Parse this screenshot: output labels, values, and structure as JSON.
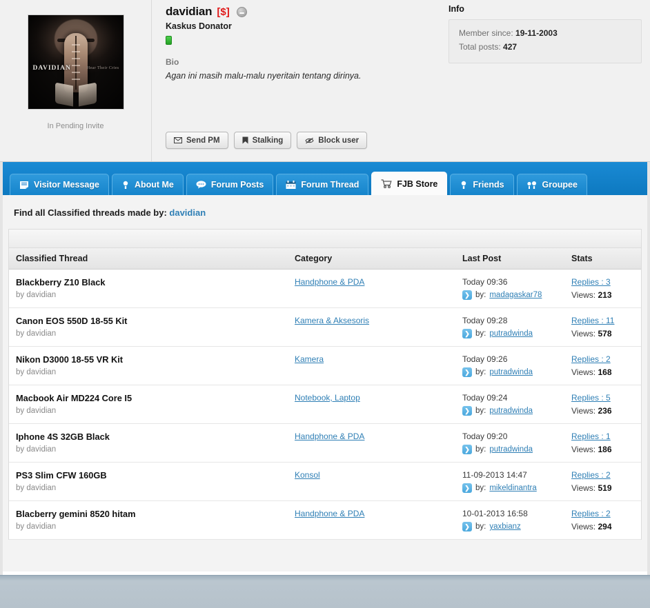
{
  "profile": {
    "avatar": {
      "artwork_title": "DAVIDIAN",
      "artwork_subtitle": "Hear Their Cries",
      "caption": "In Pending Invite"
    },
    "username": "davidian",
    "donator_badge": "[$]",
    "user_title": "Kaskus Donator",
    "bio_label": "Bio",
    "bio_text": "Agan ini masih malu-malu nyeritain tentang dirinya.",
    "buttons": [
      {
        "label": "Send PM",
        "icon": "envelope-icon"
      },
      {
        "label": "Stalking",
        "icon": "bookmark-icon"
      },
      {
        "label": "Block user",
        "icon": "block-eye-icon"
      }
    ],
    "info": {
      "heading": "Info",
      "member_since_label": "Member since:",
      "member_since_value": "19-11-2003",
      "total_posts_label": "Total posts:",
      "total_posts_value": "427"
    }
  },
  "tabs": [
    {
      "label": "Visitor Message",
      "icon": "note-icon",
      "active": false
    },
    {
      "label": "About Me",
      "icon": "person-icon",
      "active": false
    },
    {
      "label": "Forum Posts",
      "icon": "speech-bubble-icon",
      "active": false
    },
    {
      "label": "Forum Thread",
      "icon": "calendar-icon",
      "active": false
    },
    {
      "label": "FJB Store",
      "icon": "shopping-cart-icon",
      "active": true
    },
    {
      "label": "Friends",
      "icon": "person-icon",
      "active": false
    },
    {
      "label": "Groupee",
      "icon": "people-icon",
      "active": false
    }
  ],
  "find_line": {
    "prefix": "Find all Classified threads made by:",
    "username": "davidian"
  },
  "table": {
    "headers": [
      "Classified Thread",
      "Category",
      "Last Post",
      "Stats"
    ],
    "by_prefix": "by",
    "lastpost_by_prefix": "by:",
    "views_label": "Views:",
    "rows": [
      {
        "title": "Blackberry Z10 Black",
        "author": "davidian",
        "category": "Handphone & PDA",
        "last_post_date": "Today 09:36",
        "last_post_by": "madagaskar78",
        "replies": "Replies : 3",
        "views": "213"
      },
      {
        "title": "Canon EOS 550D 18-55 Kit",
        "author": "davidian",
        "category": "Kamera & Aksesoris",
        "last_post_date": "Today 09:28",
        "last_post_by": "putradwinda",
        "replies": "Replies : 11",
        "views": "578"
      },
      {
        "title": "Nikon D3000 18-55 VR Kit",
        "author": "davidian",
        "category": "Kamera",
        "last_post_date": "Today 09:26",
        "last_post_by": "putradwinda",
        "replies": "Replies : 2",
        "views": "168"
      },
      {
        "title": "Macbook Air MD224 Core I5",
        "author": "davidian",
        "category": "Notebook, Laptop",
        "last_post_date": "Today 09:24",
        "last_post_by": "putradwinda",
        "replies": "Replies : 5",
        "views": "236"
      },
      {
        "title": "Iphone 4S 32GB Black",
        "author": "davidian",
        "category": "Handphone & PDA",
        "last_post_date": "Today 09:20",
        "last_post_by": "putradwinda",
        "replies": "Replies : 1",
        "views": "186"
      },
      {
        "title": "PS3 Slim CFW 160GB",
        "author": "davidian",
        "category": "Konsol",
        "last_post_date": "11-09-2013 14:47",
        "last_post_by": "mikeldinantra",
        "replies": "Replies : 2",
        "views": "519"
      },
      {
        "title": "Blacberry gemini 8520 hitam",
        "author": "davidian",
        "category": "Handphone & PDA",
        "last_post_date": "10-01-2013 16:58",
        "last_post_by": "yaxbianz",
        "replies": "Replies : 2",
        "views": "294"
      }
    ]
  },
  "colors": {
    "tab_blue": "#0d79c0",
    "link_blue": "#2f7fb5",
    "donator_red": "#e01b1b",
    "online_green": "#24a024",
    "footer_gray_blue": "#b6c2cb"
  }
}
